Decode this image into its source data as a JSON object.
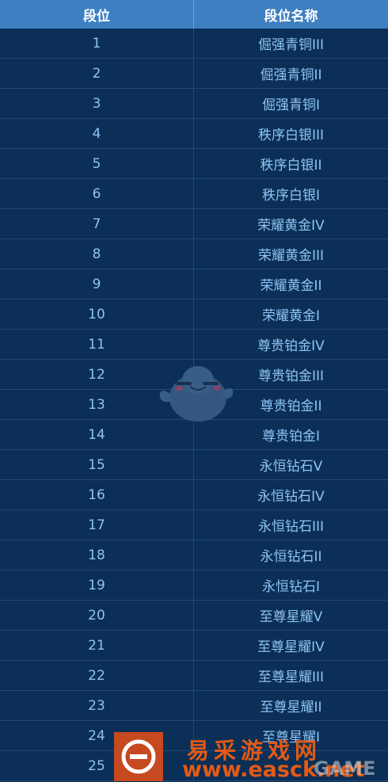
{
  "header": {
    "col1": "段位",
    "col2": "段位名称"
  },
  "rows": [
    {
      "rank": "1",
      "name": "倔强青铜III"
    },
    {
      "rank": "2",
      "name": "倔强青铜II"
    },
    {
      "rank": "3",
      "name": "倔强青铜I"
    },
    {
      "rank": "4",
      "name": "秩序白银III"
    },
    {
      "rank": "5",
      "name": "秩序白银II"
    },
    {
      "rank": "6",
      "name": "秩序白银I"
    },
    {
      "rank": "7",
      "name": "荣耀黄金IV"
    },
    {
      "rank": "8",
      "name": "荣耀黄金III"
    },
    {
      "rank": "9",
      "name": "荣耀黄金II"
    },
    {
      "rank": "10",
      "name": "荣耀黄金I"
    },
    {
      "rank": "11",
      "name": "尊贵铂金IV"
    },
    {
      "rank": "12",
      "name": "尊贵铂金III"
    },
    {
      "rank": "13",
      "name": "尊贵铂金II"
    },
    {
      "rank": "14",
      "name": "尊贵铂金I"
    },
    {
      "rank": "15",
      "name": "永恒钻石V"
    },
    {
      "rank": "16",
      "name": "永恒钻石IV"
    },
    {
      "rank": "17",
      "name": "永恒钻石III"
    },
    {
      "rank": "18",
      "name": "永恒钻石II"
    },
    {
      "rank": "19",
      "name": "永恒钻石I"
    },
    {
      "rank": "20",
      "name": "至尊星耀V"
    },
    {
      "rank": "21",
      "name": "至尊星耀IV"
    },
    {
      "rank": "22",
      "name": "至尊星耀III"
    },
    {
      "rank": "23",
      "name": "至尊星耀II"
    },
    {
      "rank": "24",
      "name": "至尊星耀I"
    },
    {
      "rank": "25",
      "name": ""
    }
  ],
  "watermark": {
    "brand_cn": "易采游戏网",
    "url": "www.easck.net",
    "suffix": "GAME",
    "logo_letter": "e",
    "icons": [
      "mascot-icon",
      "easck-logo-icon"
    ]
  },
  "colors": {
    "header_bg": "#3d7fc1",
    "table_bg": "#0b2f57",
    "text": "#8fc3f3",
    "watermark": "#e35a16"
  }
}
